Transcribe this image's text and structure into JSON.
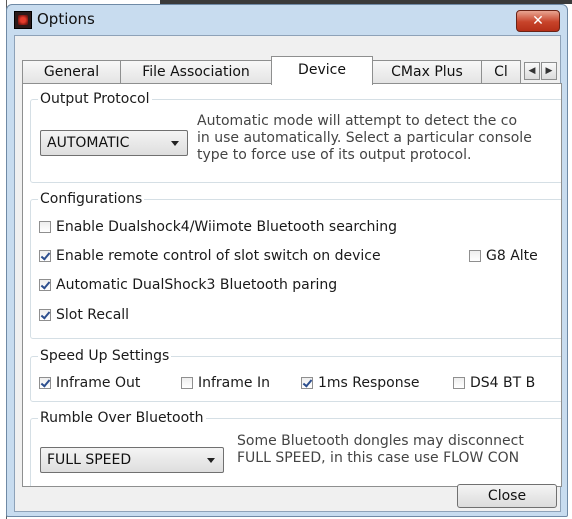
{
  "window": {
    "title": "Options",
    "close_label": "✕"
  },
  "tabs": [
    {
      "label": "General",
      "active": false
    },
    {
      "label": "File Association",
      "active": false
    },
    {
      "label": "Device",
      "active": true
    },
    {
      "label": "CMax Plus",
      "active": false
    },
    {
      "label": "Cl",
      "active": false
    }
  ],
  "tab_scroll": {
    "left": "◀",
    "right": "▶"
  },
  "output_protocol": {
    "label": "Output Protocol",
    "selected": "AUTOMATIC",
    "description": [
      "Automatic mode will attempt to detect the co",
      "in use automatically. Select a particular console",
      "type to force use of its output protocol."
    ]
  },
  "configurations": {
    "label": "Configurations",
    "items": [
      {
        "label": "Enable Dualshock4/Wiimote Bluetooth searching",
        "checked": false
      },
      {
        "label": "Enable remote control of slot switch on device",
        "checked": true
      },
      {
        "label": "G8 Alte",
        "checked": false
      },
      {
        "label": "Automatic DualShock3 Bluetooth paring",
        "checked": true
      },
      {
        "label": "Slot Recall",
        "checked": true
      }
    ]
  },
  "speed_up": {
    "label": "Speed Up Settings",
    "items": [
      {
        "label": "Inframe Out",
        "checked": true
      },
      {
        "label": "Inframe In",
        "checked": false
      },
      {
        "label": "1ms Response",
        "checked": true
      },
      {
        "label": "DS4 BT B",
        "checked": false
      }
    ]
  },
  "rumble": {
    "label": "Rumble Over Bluetooth",
    "selected": "FULL SPEED",
    "description": [
      "Some Bluetooth dongles may disconnect",
      "FULL SPEED, in this case use FLOW CON"
    ]
  },
  "footer": {
    "close_label": "Close"
  }
}
